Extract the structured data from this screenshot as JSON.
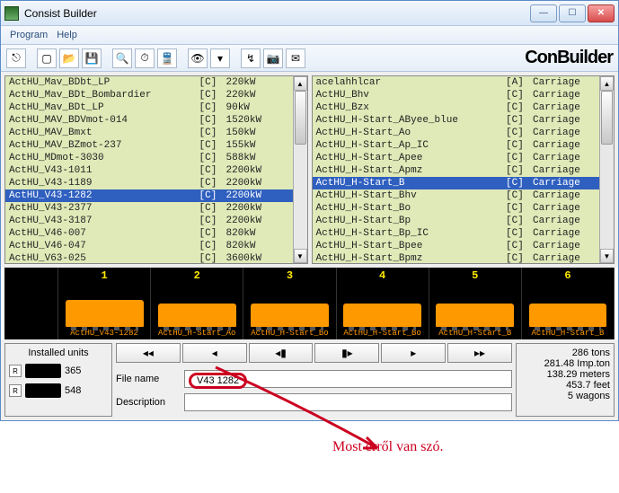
{
  "window": {
    "title": "Consist Builder"
  },
  "menu": {
    "program": "Program",
    "help": "Help"
  },
  "brand": "ConBuilder",
  "left_list": [
    {
      "name": "ActHU_Mav_BDbt_LP",
      "tag": "[C]",
      "val": "220kW",
      "sel": false
    },
    {
      "name": "ActHU_Mav_BDt_Bombardier",
      "tag": "[C]",
      "val": "220kW",
      "sel": false
    },
    {
      "name": "ActHU_Mav_BDt_LP",
      "tag": "[C]",
      "val": "90kW",
      "sel": false
    },
    {
      "name": "ActHU_MAV_BDVmot-014",
      "tag": "[C]",
      "val": "1520kW",
      "sel": false
    },
    {
      "name": "ActHU_MAV_Bmxt",
      "tag": "[C]",
      "val": "150kW",
      "sel": false
    },
    {
      "name": "ActHU_MAV_BZmot-237",
      "tag": "[C]",
      "val": "155kW",
      "sel": false
    },
    {
      "name": "ActHU_MDmot-3030",
      "tag": "[C]",
      "val": "588kW",
      "sel": false
    },
    {
      "name": "ActHU_V43-1011",
      "tag": "[C]",
      "val": "2200kW",
      "sel": false
    },
    {
      "name": "ActHU_V43-1189",
      "tag": "[C]",
      "val": "2200kW",
      "sel": false
    },
    {
      "name": "ActHU_V43-1282",
      "tag": "[C]",
      "val": "2200kW",
      "sel": true
    },
    {
      "name": "ActHU_V43-2377",
      "tag": "[C]",
      "val": "2200kW",
      "sel": false
    },
    {
      "name": "ActHU_V43-3187",
      "tag": "[C]",
      "val": "2200kW",
      "sel": false
    },
    {
      "name": "ActHU_V46-007",
      "tag": "[C]",
      "val": "820kW",
      "sel": false
    },
    {
      "name": "ActHU_V46-047",
      "tag": "[C]",
      "val": "820kW",
      "sel": false
    },
    {
      "name": "ActHU_V63-025",
      "tag": "[C]",
      "val": "3600kW",
      "sel": false
    }
  ],
  "right_list": [
    {
      "name": "acelahhlcar",
      "tag": "[A]",
      "val": "Carriage",
      "sel": false
    },
    {
      "name": "ActHU_Bhv",
      "tag": "[C]",
      "val": "Carriage",
      "sel": false
    },
    {
      "name": "ActHU_Bzx",
      "tag": "[C]",
      "val": "Carriage",
      "sel": false
    },
    {
      "name": "ActHU_H-Start_AByee_blue",
      "tag": "[C]",
      "val": "Carriage",
      "sel": false
    },
    {
      "name": "ActHU_H-Start_Ao",
      "tag": "[C]",
      "val": "Carriage",
      "sel": false
    },
    {
      "name": "ActHU_H-Start_Ap_IC",
      "tag": "[C]",
      "val": "Carriage",
      "sel": false
    },
    {
      "name": "ActHU_H-Start_Apee",
      "tag": "[C]",
      "val": "Carriage",
      "sel": false
    },
    {
      "name": "ActHU_H-Start_Apmz",
      "tag": "[C]",
      "val": "Carriage",
      "sel": false
    },
    {
      "name": "ActHU_H-Start_B",
      "tag": "[C]",
      "val": "Carriage",
      "sel": true
    },
    {
      "name": "ActHU_H-Start_Bhv",
      "tag": "[C]",
      "val": "Carriage",
      "sel": false
    },
    {
      "name": "ActHU_H-Start_Bo",
      "tag": "[C]",
      "val": "Carriage",
      "sel": false
    },
    {
      "name": "ActHU_H-Start_Bp",
      "tag": "[C]",
      "val": "Carriage",
      "sel": false
    },
    {
      "name": "ActHU_H-Start_Bp_IC",
      "tag": "[C]",
      "val": "Carriage",
      "sel": false
    },
    {
      "name": "ActHU_H-Start_Bpee",
      "tag": "[C]",
      "val": "Carriage",
      "sel": false
    },
    {
      "name": "ActHU_H-Start_Bpmz",
      "tag": "[C]",
      "val": "Carriage",
      "sel": false
    }
  ],
  "slots": [
    {
      "num": "1",
      "label": "ActHU_V43-1282"
    },
    {
      "num": "2",
      "label": "ActHU_H-Start_Ao"
    },
    {
      "num": "3",
      "label": "ActHU_H-Start_Bo"
    },
    {
      "num": "4",
      "label": "ActHU_H-Start_Bo"
    },
    {
      "num": "5",
      "label": "ActHU_H-Start_B"
    },
    {
      "num": "6",
      "label": "ActHU_H-Start_B"
    }
  ],
  "installed": {
    "title": "Installed units",
    "u1": "365",
    "u2": "548"
  },
  "fields": {
    "file_label": "File name",
    "file_value": "V43 1282",
    "desc_label": "Description",
    "desc_value": ""
  },
  "stats": {
    "l1": "286  tons",
    "l2": "281.48  Imp.ton",
    "l3": "138.29  meters",
    "l4": "453.7  feet",
    "l5": "5  wagons"
  },
  "annotation": "Most erről van szó."
}
